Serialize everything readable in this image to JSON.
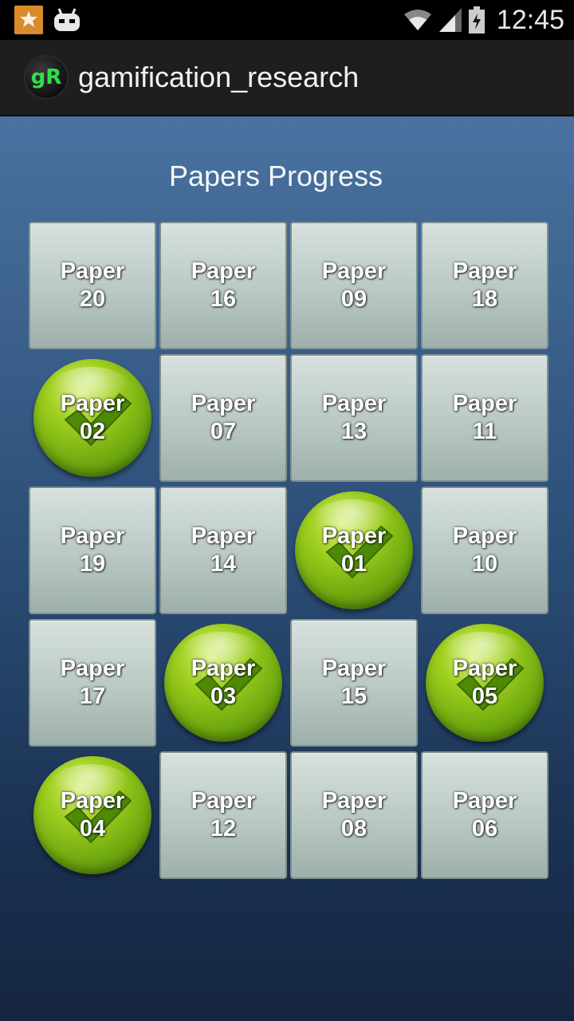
{
  "status_bar": {
    "time": "12:45",
    "icons": [
      "notification-icon",
      "cyanogen-robot-icon",
      "wifi-icon",
      "signal-icon",
      "battery-charging-icon"
    ]
  },
  "app_bar": {
    "logo_text": "gR",
    "title": "gamification_research"
  },
  "main": {
    "heading": "Papers Progress",
    "tiles": [
      {
        "label": "Paper\n20",
        "completed": false
      },
      {
        "label": "Paper\n16",
        "completed": false
      },
      {
        "label": "Paper\n09",
        "completed": false
      },
      {
        "label": "Paper\n18",
        "completed": false
      },
      {
        "label": "Paper\n02",
        "completed": true
      },
      {
        "label": "Paper\n07",
        "completed": false
      },
      {
        "label": "Paper\n13",
        "completed": false
      },
      {
        "label": "Paper\n11",
        "completed": false
      },
      {
        "label": "Paper\n19",
        "completed": false
      },
      {
        "label": "Paper\n14",
        "completed": false
      },
      {
        "label": "Paper\n01",
        "completed": true
      },
      {
        "label": "Paper\n10",
        "completed": false
      },
      {
        "label": "Paper\n17",
        "completed": false
      },
      {
        "label": "Paper\n03",
        "completed": true
      },
      {
        "label": "Paper\n15",
        "completed": false
      },
      {
        "label": "Paper\n05",
        "completed": true
      },
      {
        "label": "Paper\n04",
        "completed": true
      },
      {
        "label": "Paper\n12",
        "completed": false
      },
      {
        "label": "Paper\n08",
        "completed": false
      },
      {
        "label": "Paper\n06",
        "completed": false
      }
    ]
  },
  "colors": {
    "completed": "#8cc21a",
    "pending_tile": "#b9c8c3",
    "background_top": "#4a72a0",
    "background_bottom": "#15253f"
  }
}
